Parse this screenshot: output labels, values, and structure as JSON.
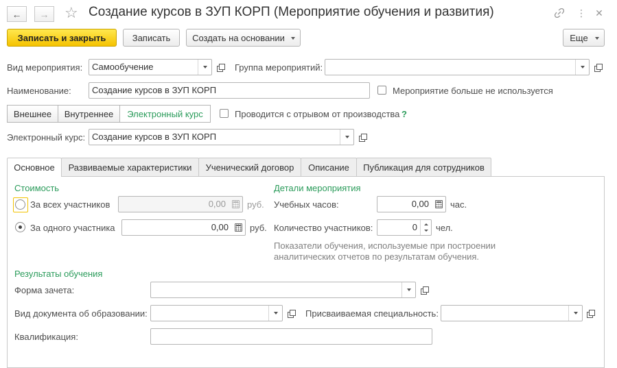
{
  "window": {
    "title": "Создание курсов в ЗУП КОРП (Мероприятие обучения и развития)",
    "back_glyph": "←",
    "forward_glyph": "→",
    "star_glyph": "☆",
    "link_glyph": "🔗",
    "more_glyph": "⋮",
    "close_glyph": "✕"
  },
  "toolbar": {
    "save_close": "Записать и закрыть",
    "save": "Записать",
    "create_based": "Создать на основании",
    "more": "Еще"
  },
  "form": {
    "event_type_label": "Вид мероприятия:",
    "event_type_value": "Самообучение",
    "event_group_label": "Группа мероприятий:",
    "event_group_value": "",
    "name_label": "Наименование:",
    "name_value": "Создание курсов в ЗУП КОРП",
    "not_used_label": "Мероприятие больше не используется",
    "mode_external": "Внешнее",
    "mode_internal": "Внутреннее",
    "mode_elearning": "Электронный курс",
    "off_job_label": "Проводится с отрывом от производства",
    "help": "?",
    "ecourse_label": "Электронный курс:",
    "ecourse_value": "Создание курсов в ЗУП КОРП"
  },
  "tabs": [
    {
      "label": "Основное"
    },
    {
      "label": "Развиваемые характеристики"
    },
    {
      "label": "Ученический договор"
    },
    {
      "label": "Описание"
    },
    {
      "label": "Публикация для сотрудников"
    }
  ],
  "cost": {
    "header": "Стоимость",
    "all_label": "За всех участников",
    "all_value": "0,00",
    "one_label": "За одного участника",
    "one_value": "0,00",
    "currency": "руб."
  },
  "details": {
    "header": "Детали мероприятия",
    "hours_label": "Учебных часов:",
    "hours_value": "0,00",
    "hours_unit": "час.",
    "participants_label": "Количество участников:",
    "participants_value": "0",
    "participants_unit": "чел.",
    "note": "Показатели обучения, используемые при построении аналитических отчетов по результатам обучения."
  },
  "results": {
    "header": "Результаты обучения",
    "form_label": "Форма зачета:",
    "form_value": "",
    "doc_label": "Вид документа об образовании:",
    "doc_value": "",
    "specialty_label": "Присваиваемая специальность:",
    "specialty_value": "",
    "qualification_label": "Квалификация:",
    "qualification_value": ""
  }
}
